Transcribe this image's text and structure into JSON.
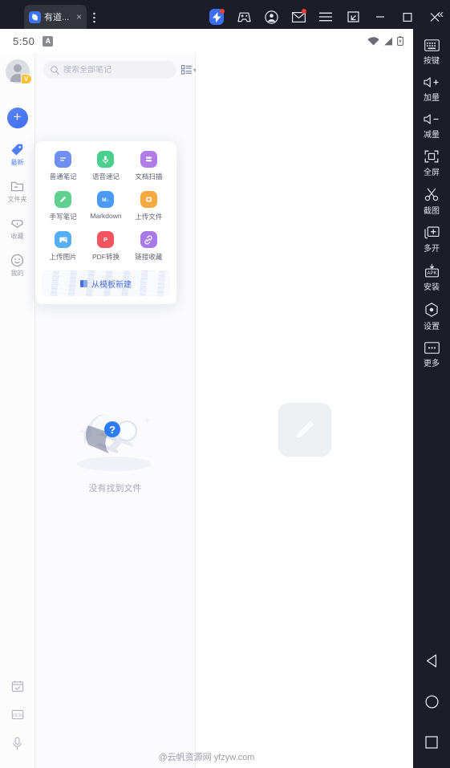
{
  "titlebar": {
    "tab_title": "有道...",
    "tab_close": "×",
    "tab_menu_icon": "vertical-dots-icon",
    "icons": [
      {
        "name": "boost-icon",
        "badge": true
      },
      {
        "name": "gamepad-icon",
        "badge": false
      },
      {
        "name": "account-icon",
        "badge": false
      },
      {
        "name": "mail-icon",
        "badge": true
      },
      {
        "name": "hamburger-menu-icon",
        "badge": false
      },
      {
        "name": "screenshot-icon",
        "badge": false
      }
    ],
    "minimize": "–",
    "maximize": "□",
    "close": "×",
    "collapse": "«"
  },
  "statusbar": {
    "clock": "5:50",
    "input_badge": "A",
    "wifi_icon": "wifi-icon",
    "signal_icon": "signal-icon",
    "battery_icon": "battery-charging-icon"
  },
  "rail": {
    "avatar_badge": "V",
    "new_button": "+",
    "items": [
      {
        "label": "最新",
        "icon": "tag-icon",
        "active": true
      },
      {
        "label": "文件夹",
        "icon": "folder-icon",
        "active": false
      },
      {
        "label": "收藏",
        "icon": "diamond-icon",
        "active": false
      },
      {
        "label": "我的",
        "icon": "smiley-icon",
        "active": false
      }
    ],
    "bottom_icons": [
      {
        "name": "calendar-icon"
      },
      {
        "name": "ocr-icon"
      },
      {
        "name": "microphone-icon"
      }
    ]
  },
  "search": {
    "placeholder": "搜索全部笔记",
    "value": "",
    "icon": "search-icon",
    "sort_icon": "list-view-icon",
    "sort_caret": "▾"
  },
  "popover": {
    "items": [
      {
        "label": "普通笔记",
        "icon": "note-icon",
        "color": "#6f8ff0"
      },
      {
        "label": "语音速记",
        "icon": "microphone-icon",
        "color": "#4bcf8e"
      },
      {
        "label": "文档扫描",
        "icon": "scan-doc-icon",
        "color": "#b07ce8"
      },
      {
        "label": "手写笔记",
        "icon": "handwriting-icon",
        "color": "#5fd08f"
      },
      {
        "label": "Markdown",
        "icon": "markdown-icon",
        "color": "#4b9af5"
      },
      {
        "label": "上传文件",
        "icon": "upload-file-icon",
        "color": "#f5a93f"
      },
      {
        "label": "上传图片",
        "icon": "upload-image-icon",
        "color": "#56aef5"
      },
      {
        "label": "PDF转换",
        "icon": "pdf-icon",
        "color": "#f2555f"
      },
      {
        "label": "链接收藏",
        "icon": "link-icon",
        "color": "#a879e8"
      }
    ],
    "template_button": "从模板新建"
  },
  "list": {
    "empty_text": "没有找到文件",
    "empty_icon": "empty-search-illustration"
  },
  "editor": {
    "placeholder_icon": "pencil-icon",
    "watermark": "@云帆资源网 yfzyw.com"
  },
  "toolrail": {
    "tools": [
      {
        "label": "按键",
        "icon": "keyboard-icon"
      },
      {
        "label": "加量",
        "icon": "volume-up-icon"
      },
      {
        "label": "减量",
        "icon": "volume-down-icon"
      },
      {
        "label": "全屏",
        "icon": "fullscreen-icon"
      },
      {
        "label": "截图",
        "icon": "scissors-icon"
      },
      {
        "label": "多开",
        "icon": "multi-instance-icon"
      },
      {
        "label": "安装",
        "icon": "apk-install-icon"
      },
      {
        "label": "设置",
        "icon": "settings-icon"
      },
      {
        "label": "更多",
        "icon": "more-icon"
      }
    ],
    "nav": [
      {
        "name": "android-back-button",
        "glyph": "back-triangle-icon"
      },
      {
        "name": "android-home-button",
        "glyph": "home-circle-icon"
      },
      {
        "name": "android-recents-button",
        "glyph": "recents-square-icon"
      }
    ]
  },
  "colors": {
    "accent": "#4a6fe0",
    "titlebar_bg": "#1d1d29",
    "screen_bg": "#ffffff",
    "badge_red": "#ef4136",
    "vip_yellow": "#fcc02e"
  }
}
